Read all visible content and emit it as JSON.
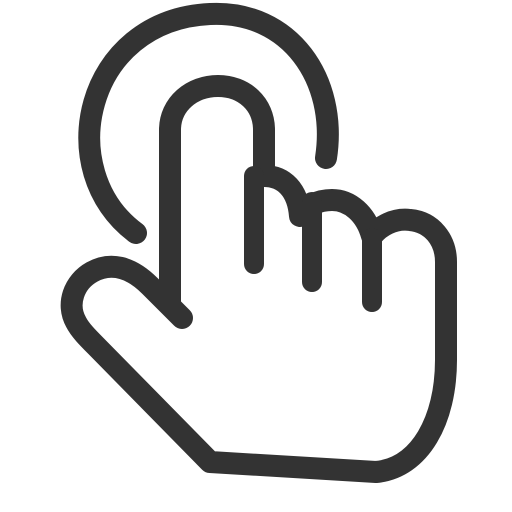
{
  "icon": {
    "name": "tap-gesture-icon",
    "stroke_color": "#333333",
    "fill_color": "#ffffff",
    "background_color": "#ffffff"
  }
}
